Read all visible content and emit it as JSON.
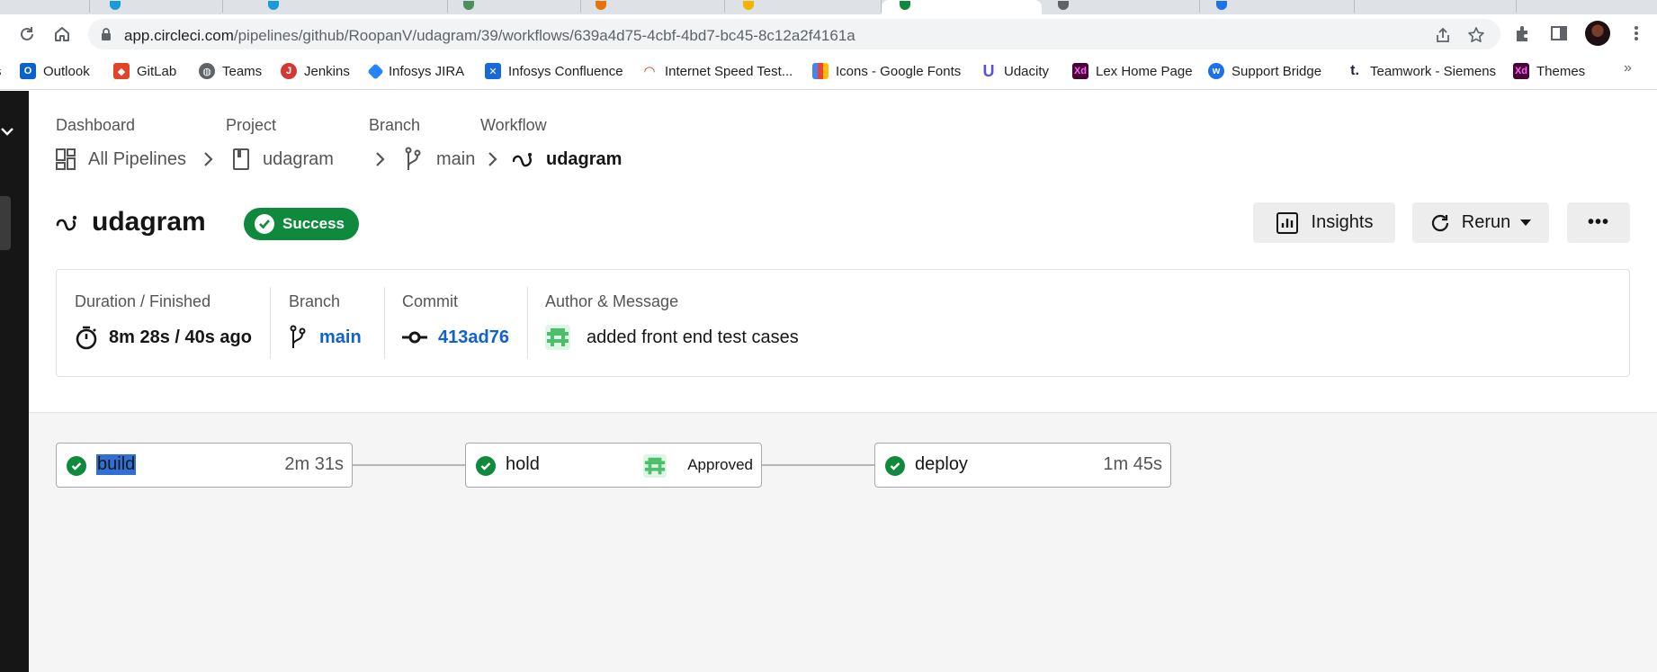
{
  "browser": {
    "url_host": "app.circleci.com",
    "url_path": "/pipelines/github/RoopanV/udagram/39/workflows/639a4d75-4cbf-4bd7-bc45-8c12a2f4161a",
    "bookmarks": [
      {
        "label": "Outlook",
        "icon": "outlook-icon",
        "color": "#0a64c8"
      },
      {
        "label": "GitLab",
        "icon": "gitlab-icon",
        "color": "#e24329"
      },
      {
        "label": "Teams",
        "icon": "globe-icon",
        "color": "#5f6368"
      },
      {
        "label": "Jenkins",
        "icon": "jenkins-icon",
        "color": "#d33833"
      },
      {
        "label": "Infosys JIRA",
        "icon": "jira-icon",
        "color": "#2684ff"
      },
      {
        "label": "Infosys Confluence",
        "icon": "confluence-icon",
        "color": "#1868db"
      },
      {
        "label": "Internet Speed Test...",
        "icon": "speedometer-icon",
        "color": "#e0322b"
      },
      {
        "label": "Icons - Google Fonts",
        "icon": "google-fonts-icon",
        "color": "#4285f4"
      },
      {
        "label": "Udacity",
        "icon": "udacity-icon",
        "color": "#5a50e0"
      },
      {
        "label": "Lex Home Page",
        "icon": "xd-icon",
        "color": "#470137"
      },
      {
        "label": "Support Bridge",
        "icon": "bridge-icon",
        "color": "#1a73e8"
      },
      {
        "label": "Teamwork - Siemens",
        "icon": "teamwork-icon",
        "color": "#2b1a3d"
      },
      {
        "label": "Themes",
        "icon": "xd-icon",
        "color": "#470137"
      }
    ],
    "more_bookmarks": "»"
  },
  "breadcrumb": {
    "labels": [
      "Dashboard",
      "Project",
      "Branch",
      "Workflow"
    ],
    "all_pipelines": "All Pipelines",
    "project": "udagram",
    "branch": "main",
    "workflow": "udagram"
  },
  "workflow": {
    "title": "udagram",
    "status": "Success",
    "status_color": "#0f8a3c"
  },
  "actions": {
    "insights": "Insights",
    "rerun": "Rerun",
    "more": "•••"
  },
  "info": {
    "duration_label": "Duration / Finished",
    "duration_value": "8m 28s / 40s ago",
    "branch_label": "Branch",
    "branch_value": "main",
    "commit_label": "Commit",
    "commit_value": "413ad76",
    "author_label": "Author & Message",
    "message": "added front end test cases"
  },
  "jobs": [
    {
      "name": "build",
      "duration": "2m 31s",
      "selected": true
    },
    {
      "name": "hold",
      "approval": "Approved"
    },
    {
      "name": "deploy",
      "duration": "1m 45s"
    }
  ],
  "colors": {
    "accent_link": "#1260cc",
    "success": "#0f8a3c",
    "sidebar": "#161616"
  }
}
